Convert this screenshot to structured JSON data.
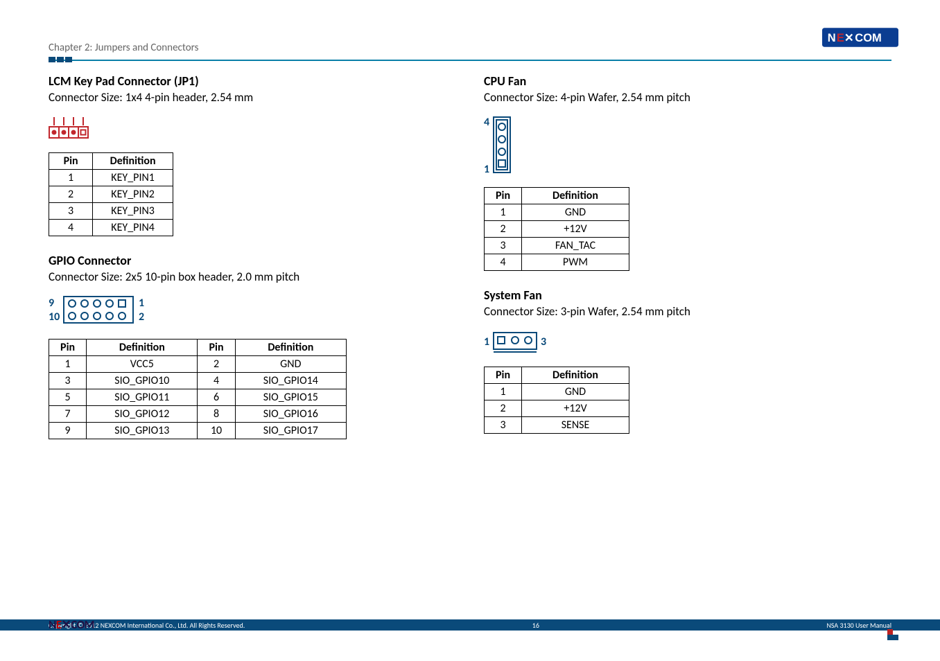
{
  "chapter": "Chapter 2: Jumpers and Connectors",
  "logo_text": "NEXCOM",
  "left": {
    "jp1": {
      "title": "LCM Key Pad Connector (JP1)",
      "sub": "Connector Size: 1x4 4-pin header, 2.54 mm",
      "headers": [
        "Pin",
        "Definition"
      ],
      "rows": [
        [
          "1",
          "KEY_PIN1"
        ],
        [
          "2",
          "KEY_PIN2"
        ],
        [
          "3",
          "KEY_PIN3"
        ],
        [
          "4",
          "KEY_PIN4"
        ]
      ]
    },
    "gpio": {
      "title": "GPIO Connector",
      "sub": "Connector Size: 2x5 10-pin box header, 2.0 mm pitch",
      "diag_labels": {
        "tl": "9",
        "bl": "10",
        "tr": "1",
        "br": "2"
      },
      "headers": [
        "Pin",
        "Definition",
        "Pin",
        "Definition"
      ],
      "rows": [
        [
          "1",
          "VCC5",
          "2",
          "GND"
        ],
        [
          "3",
          "SIO_GPIO10",
          "4",
          "SIO_GPIO14"
        ],
        [
          "5",
          "SIO_GPIO11",
          "6",
          "SIO_GPIO15"
        ],
        [
          "7",
          "SIO_GPIO12",
          "8",
          "SIO_GPIO16"
        ],
        [
          "9",
          "SIO_GPIO13",
          "10",
          "SIO_GPIO17"
        ]
      ]
    }
  },
  "right": {
    "cpufan": {
      "title": "CPU Fan",
      "sub": "Connector Size: 4-pin Wafer, 2.54 mm pitch",
      "diag_labels": {
        "top": "4",
        "bot": "1"
      },
      "headers": [
        "Pin",
        "Definition"
      ],
      "rows": [
        [
          "1",
          "GND"
        ],
        [
          "2",
          "+12V"
        ],
        [
          "3",
          "FAN_TAC"
        ],
        [
          "4",
          "PWM"
        ]
      ]
    },
    "sysfan": {
      "title": "System Fan",
      "sub": "Connector Size: 3-pin Wafer, 2.54 mm pitch",
      "diag_labels": {
        "left": "1",
        "right": "3"
      },
      "headers": [
        "Pin",
        "Definition"
      ],
      "rows": [
        [
          "1",
          "GND"
        ],
        [
          "2",
          "+12V"
        ],
        [
          "3",
          "SENSE"
        ]
      ]
    }
  },
  "footer": {
    "copyright": "Copyright © 2012 NEXCOM International Co., Ltd. All Rights Reserved.",
    "page": "16",
    "doc": "NSA 3130 User Manual"
  }
}
